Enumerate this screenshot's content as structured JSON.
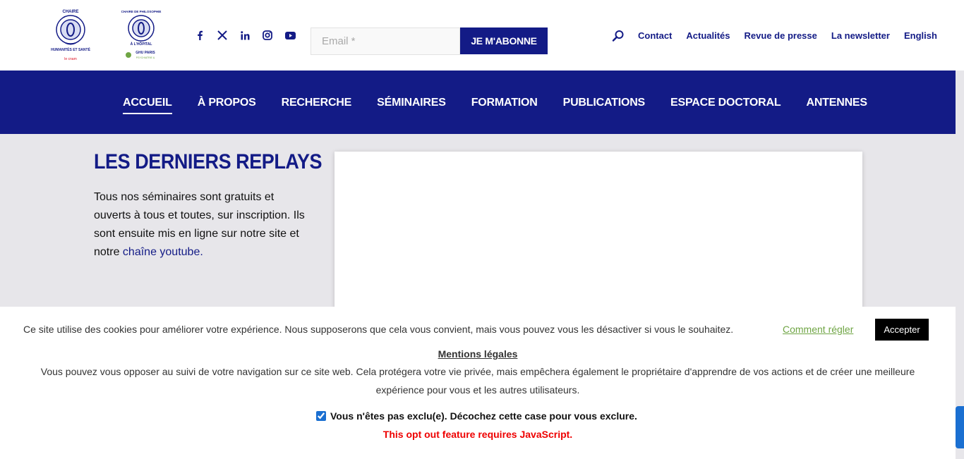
{
  "header": {
    "logo1_alt": "Chaire Humanités et Santé le cnam",
    "logo2_alt": "Chaire de Philosophie à l'Hôpital GHU Paris",
    "social_icons": [
      "facebook-icon",
      "x-icon",
      "linkedin-icon",
      "instagram-icon",
      "youtube-icon"
    ],
    "email_placeholder": "Email *",
    "subscribe_label": "JE M'ABONNE",
    "links": [
      "Contact",
      "Actualités",
      "Revue de presse",
      "La newsletter",
      "English"
    ]
  },
  "nav": {
    "items": [
      "ACCUEIL",
      "À PROPOS",
      "RECHERCHE",
      "SÉMINAIRES",
      "FORMATION",
      "PUBLICATIONS",
      "ESPACE DOCTORAL",
      "ANTENNES"
    ],
    "active": "ACCUEIL"
  },
  "main": {
    "heading": "LES DERNIERS REPLAYS",
    "intro": "Tous nos séminaires sont gratuits et ouverts à tous et toutes, sur inscription. Ils sont ensuite mis en ligne sur notre site et notre ",
    "intro_link": "chaîne youtube."
  },
  "cookie": {
    "message": "Ce site utilise des cookies pour améliorer votre expérience. Nous supposerons que cela vous convient, mais vous pouvez vous les désactiver si vous le souhaitez.",
    "settings_label": "Comment régler",
    "accept_label": "Accepter",
    "legal_title": "Mentions légales",
    "legal_text": "Vous pouvez vous opposer au suivi de votre navigation sur ce site web. Cela protégera votre vie privée, mais empêchera également le propriétaire d'apprendre de vos actions et de créer une meilleure expérience pour vous et les autres utilisateurs.",
    "optout_label": "Vous n'êtes pas exclu(e). Décochez cette case pour vous exclure.",
    "js_warning": "This opt out feature requires JavaScript."
  },
  "colors": {
    "brand_blue": "#131b86",
    "accent_green": "#6fa544",
    "warning_red": "#e00000"
  }
}
